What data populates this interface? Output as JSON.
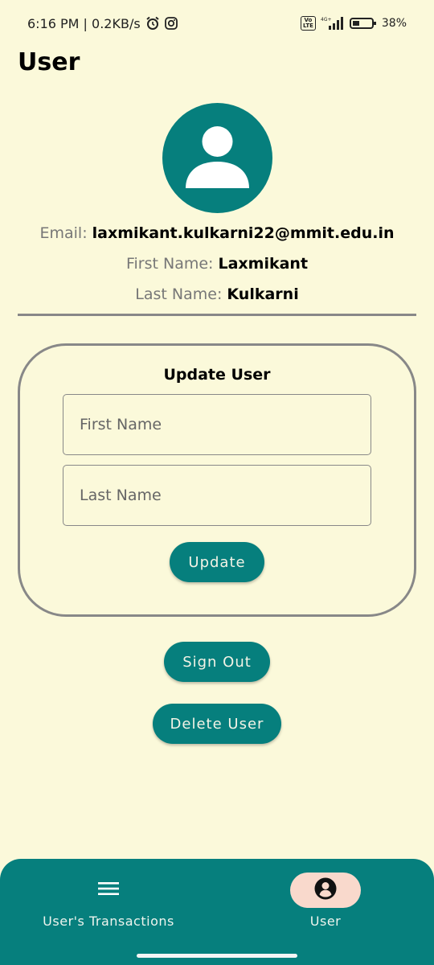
{
  "status_bar": {
    "time_speed": "6:16 PM | 0.2KB/s",
    "network": "4G+",
    "battery": "38%",
    "icons": [
      "alarm-icon",
      "instagram-icon",
      "volte-icon",
      "signal-icon",
      "battery-icon"
    ]
  },
  "page": {
    "title": "User"
  },
  "profile": {
    "avatar_icon": "user-avatar-icon",
    "email_label": "Email:",
    "email": "laxmikant.kulkarni22@mmit.edu.in",
    "first_name_label": "First Name:",
    "first_name": "Laxmikant",
    "last_name_label": "Last Name:",
    "last_name": "Kulkarni"
  },
  "update_form": {
    "title": "Update User",
    "first_name_placeholder": "First Name",
    "first_name_value": "",
    "last_name_placeholder": "Last Name",
    "last_name_value": "",
    "update_label": "Update"
  },
  "actions": {
    "sign_out_label": "Sign Out",
    "delete_user_label": "Delete User"
  },
  "bottom_nav": {
    "items": [
      {
        "label": "User's Transactions",
        "icon": "menu-icon",
        "active": false
      },
      {
        "label": "User",
        "icon": "account-circle-icon",
        "active": true
      }
    ]
  },
  "colors": {
    "background": "#fbf9da",
    "primary": "#067f7d",
    "active_indicator": "#f9d9cc"
  }
}
